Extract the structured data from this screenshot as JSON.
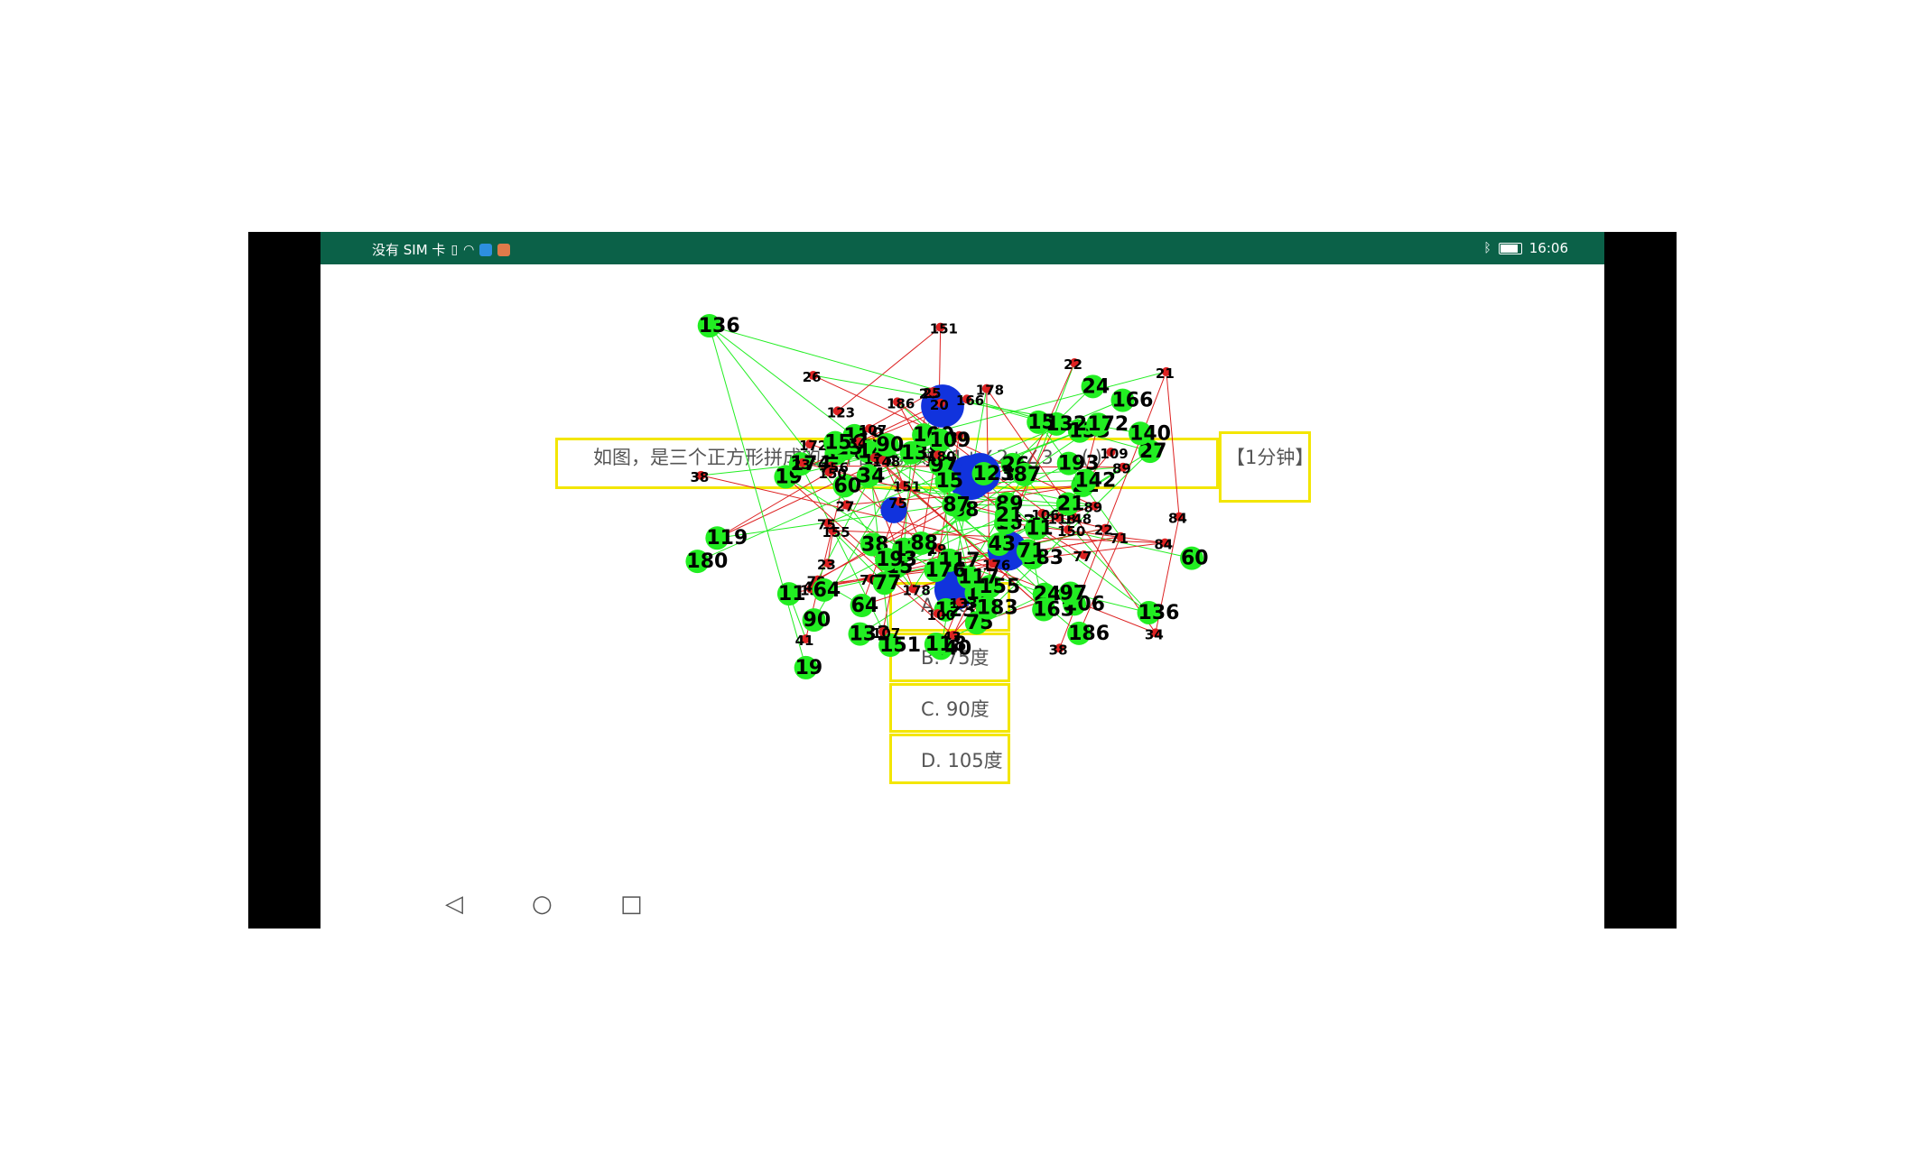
{
  "status_bar": {
    "carrier": "没有 SIM 卡",
    "time": "16:06",
    "background": "#0b6148"
  },
  "question": {
    "text": "如图，是三个正方形拼成的一个图形，则∠1+∠2+∠3 = ( )",
    "timer": "【1分钟】"
  },
  "options": [
    {
      "label": "A. 60度"
    },
    {
      "label": "B. 75度"
    },
    {
      "label": "C. 90度"
    },
    {
      "label": "D. 105度"
    }
  ],
  "nav": {
    "back": "◁",
    "home": "○",
    "recent": "□"
  },
  "overlay": {
    "colors": {
      "green": "#22ee22",
      "red": "#dd2222",
      "blue": "#1133dd",
      "box": "#f3e600"
    },
    "labels": [
      "75",
      "133",
      "26",
      "123",
      "89",
      "64",
      "176",
      "132",
      "34",
      "11",
      "22",
      "38",
      "19",
      "15",
      "21",
      "23",
      "25",
      "27",
      "20",
      "24",
      "43",
      "77",
      "88",
      "87",
      "140",
      "109",
      "163",
      "156",
      "151",
      "155",
      "136",
      "138",
      "148",
      "118",
      "119",
      "166",
      "41",
      "84",
      "117",
      "60",
      "90",
      "174",
      "183",
      "151",
      "150",
      "142",
      "100",
      "97",
      "106",
      "172",
      "193",
      "71",
      "186",
      "70",
      "178",
      "107",
      "180"
    ]
  }
}
